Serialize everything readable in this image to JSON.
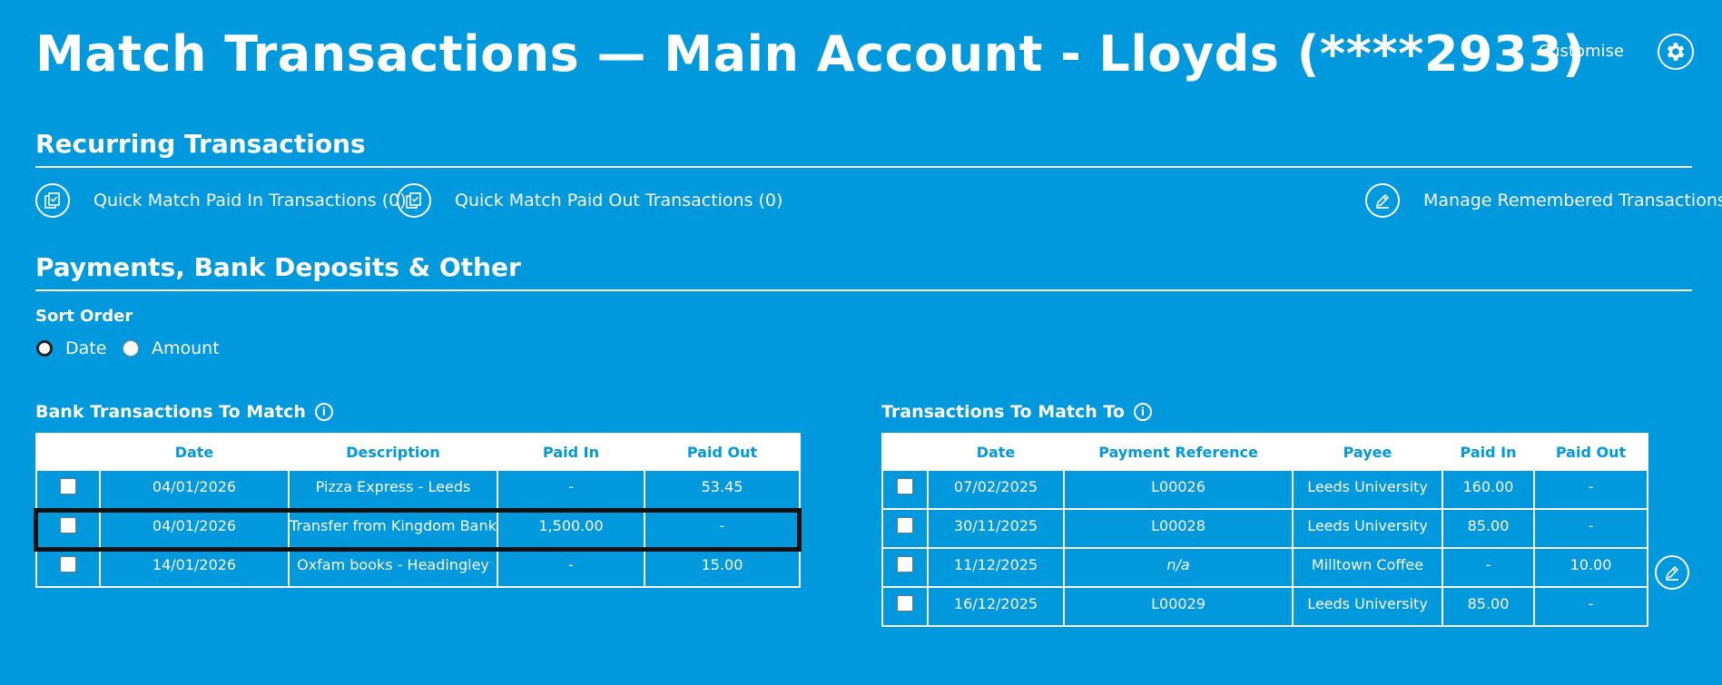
{
  "header": {
    "title": "Match Transactions — Main Account - Lloyds (****2933)",
    "customise_label": "Customise",
    "gear_icon": "gear-icon"
  },
  "recurring": {
    "title": "Recurring Transactions",
    "quick_match_in": "Quick Match Paid In Transactions (0)",
    "quick_match_out": "Quick Match Paid Out Transactions (0)",
    "manage_remembered": "Manage Remembered Transactions"
  },
  "payments": {
    "title": "Payments, Bank Deposits & Other",
    "sort_label": "Sort Order",
    "sort_options": [
      "Date",
      "Amount"
    ],
    "sort_selected": "Date"
  },
  "bank_table": {
    "title": "Bank Transactions To Match",
    "columns": [
      "Date",
      "Description",
      "Paid In",
      "Paid Out"
    ],
    "rows": [
      {
        "date": "04/01/2026",
        "description": "Pizza Express - Leeds",
        "paid_in": "-",
        "paid_out": "53.45"
      },
      {
        "date": "04/01/2026",
        "description": "Transfer from Kingdom Bank",
        "paid_in": "1,500.00",
        "paid_out": "-"
      },
      {
        "date": "14/01/2026",
        "description": "Oxfam books - Headingley",
        "paid_in": "-",
        "paid_out": "15.00"
      }
    ]
  },
  "match_table": {
    "title": "Transactions To Match To",
    "columns": [
      "Date",
      "Payment Reference",
      "Payee",
      "Paid In",
      "Paid Out"
    ],
    "rows": [
      {
        "date": "07/02/2025",
        "reference": "L00026",
        "payee": "Leeds University",
        "paid_in": "160.00",
        "paid_out": "-"
      },
      {
        "date": "30/11/2025",
        "reference": "L00028",
        "payee": "Leeds University",
        "paid_in": "85.00",
        "paid_out": "-"
      },
      {
        "date": "11/12/2025",
        "reference": "n/a",
        "payee": "Milltown Coffee",
        "paid_in": "-",
        "paid_out": "10.00"
      },
      {
        "date": "16/12/2025",
        "reference": "L00029",
        "payee": "Leeds University",
        "paid_in": "85.00",
        "paid_out": "-"
      }
    ]
  },
  "colors": {
    "background": "#0099dd",
    "text": "#ffffff",
    "highlight_border": "#111111"
  }
}
